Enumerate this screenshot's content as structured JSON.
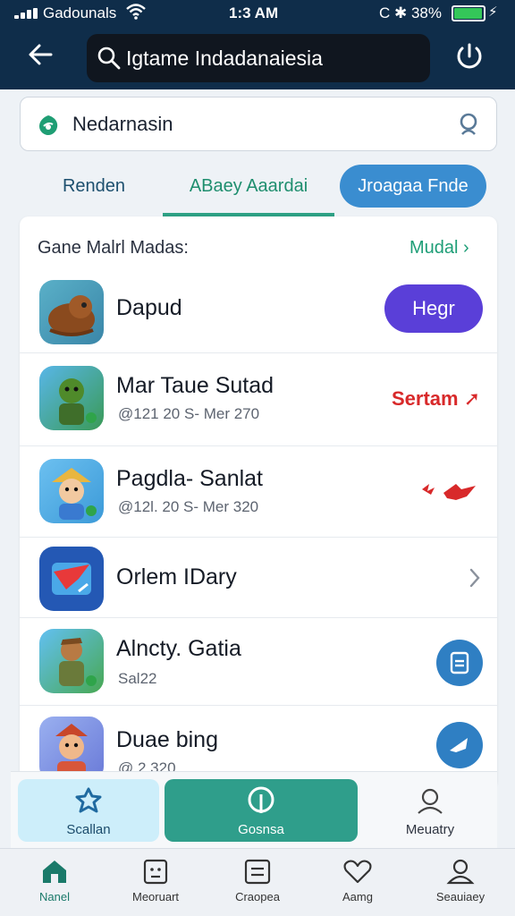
{
  "status_bar": {
    "carrier": "Gadounals",
    "time": "1:3 AM",
    "right_indicators": "C ✱ 38%",
    "battery_level": 0.9
  },
  "header": {
    "search_text": "Igtame Indadanaiesia",
    "back_icon": "back-arrow-icon",
    "power_icon": "power-icon"
  },
  "secondary_search": {
    "text": "Nedarnasin"
  },
  "tabs": [
    {
      "label": "Renden"
    },
    {
      "label": "ABaey Aaardai",
      "active": true
    },
    {
      "label": "Jroagaa Fnde"
    }
  ],
  "list": {
    "section_title": "Gane Malrl Madas:",
    "more_label": "Mudal",
    "items": [
      {
        "title": "Dapud",
        "subtitle": "",
        "action": "Hegr"
      },
      {
        "title": "Mar Taue Sutad",
        "subtitle": "@121 20 S- Mer 270",
        "action": "Sertam"
      },
      {
        "title": "Pagdla- Sanlat",
        "subtitle": "@12l. 20 S- Mer 320",
        "action": ""
      },
      {
        "title": "Orlem IDary",
        "subtitle": "",
        "action": ""
      },
      {
        "title": "Alncty. Gatia",
        "subtitle": "Sal22",
        "action": ""
      },
      {
        "title": "Duae bing",
        "subtitle": "@ 2 320",
        "action": ""
      }
    ]
  },
  "actions": [
    {
      "label": "Scallan"
    },
    {
      "label": "Gosnsa"
    },
    {
      "label": "Meuatry"
    }
  ],
  "tabbar": [
    {
      "label": "Nanel",
      "active": true
    },
    {
      "label": "Meoruart"
    },
    {
      "label": "Craopea"
    },
    {
      "label": "Aamg"
    },
    {
      "label": "Seauiaey"
    }
  ],
  "colors": {
    "header_bg": "#0f2d4a",
    "accent_green": "#2ea185",
    "accent_blue": "#3a8dd0",
    "play_button": "#5a3fd8",
    "tag_red": "#d8292a"
  }
}
